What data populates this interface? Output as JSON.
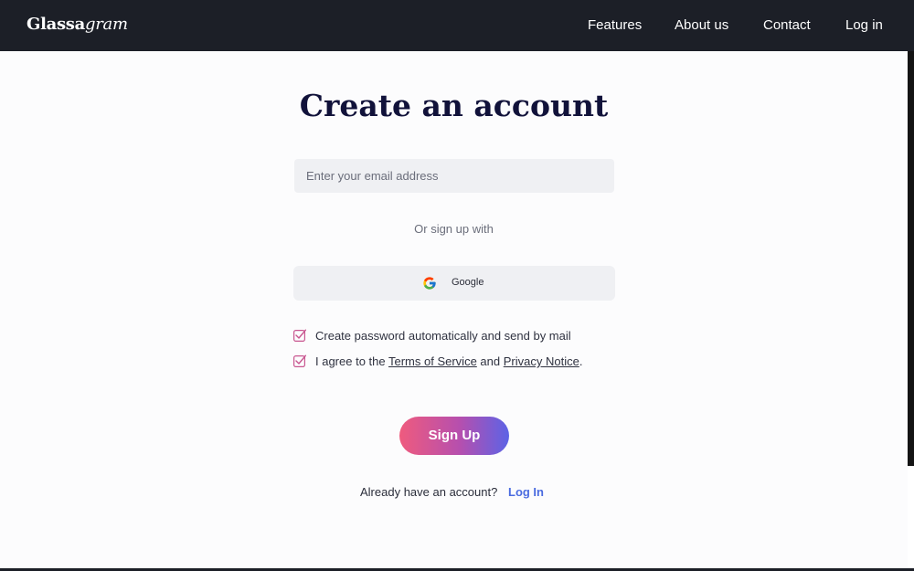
{
  "brand": {
    "part1": "Glassa",
    "part2": "gram"
  },
  "nav": {
    "features": "Features",
    "about": "About us",
    "contact": "Contact",
    "login": "Log in"
  },
  "page": {
    "title": "Create an account"
  },
  "form": {
    "email_placeholder": "Enter your email address",
    "divider": "Or sign up with",
    "google_label": "Google",
    "checkbox1": "Create password automatically and send by mail",
    "checkbox2_pre": "I agree to the ",
    "terms_link": "Terms of Service",
    "checkbox2_mid": " and ",
    "privacy_link": "Privacy Notice",
    "checkbox2_post": ".",
    "signup_label": "Sign Up",
    "already": "Already have an account?",
    "login_link": "Log In"
  },
  "icons": {
    "google": "google-icon",
    "checkbox": "checkbox-checked-icon"
  },
  "colors": {
    "nav_bg": "#1c1f27",
    "title": "#11123a",
    "link": "#4a6be0",
    "gradient_start": "#ef5b7e",
    "gradient_end": "#5c63e6"
  }
}
